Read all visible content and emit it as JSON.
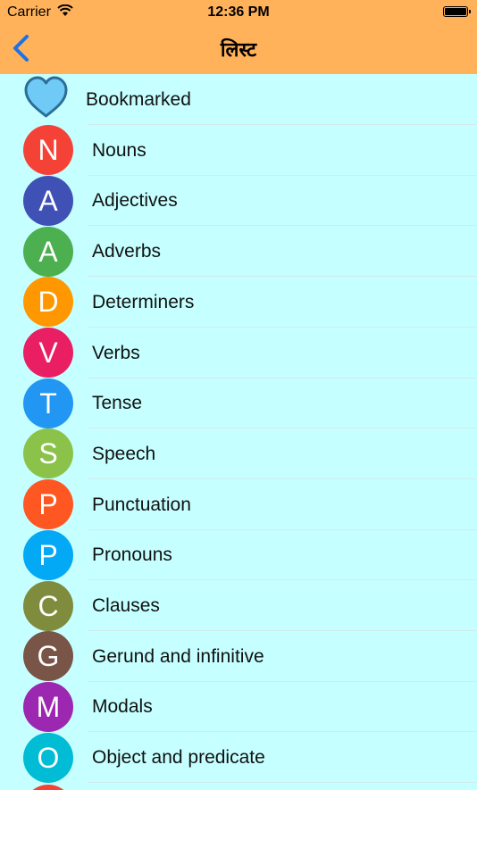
{
  "status_bar": {
    "carrier": "Carrier",
    "time": "12:36 PM"
  },
  "nav": {
    "title": "लिस्ट",
    "back_icon": "chevron-left-icon"
  },
  "bookmark": {
    "label": "Bookmarked",
    "icon": "heart-icon",
    "color": "#6fcaf5"
  },
  "items": [
    {
      "letter": "N",
      "label": "Nouns",
      "color": "#f44336"
    },
    {
      "letter": "A",
      "label": "Adjectives",
      "color": "#3f51b5"
    },
    {
      "letter": "A",
      "label": "Adverbs",
      "color": "#4caf50"
    },
    {
      "letter": "D",
      "label": "Determiners",
      "color": "#ff9800"
    },
    {
      "letter": "V",
      "label": "Verbs",
      "color": "#e91e63"
    },
    {
      "letter": "T",
      "label": "Tense",
      "color": "#2196f3"
    },
    {
      "letter": "S",
      "label": "Speech",
      "color": "#8bc34a"
    },
    {
      "letter": "P",
      "label": "Punctuation",
      "color": "#ff5722"
    },
    {
      "letter": "P",
      "label": "Pronouns",
      "color": "#03a9f4"
    },
    {
      "letter": "C",
      "label": "Clauses",
      "color": "#7f8c3d"
    },
    {
      "letter": "G",
      "label": "Gerund and infinitive",
      "color": "#795548"
    },
    {
      "letter": "M",
      "label": "Modals",
      "color": "#9c27b0"
    },
    {
      "letter": "O",
      "label": "Object and predicate",
      "color": "#00bcd4"
    }
  ],
  "partial_item_color": "#f44336"
}
